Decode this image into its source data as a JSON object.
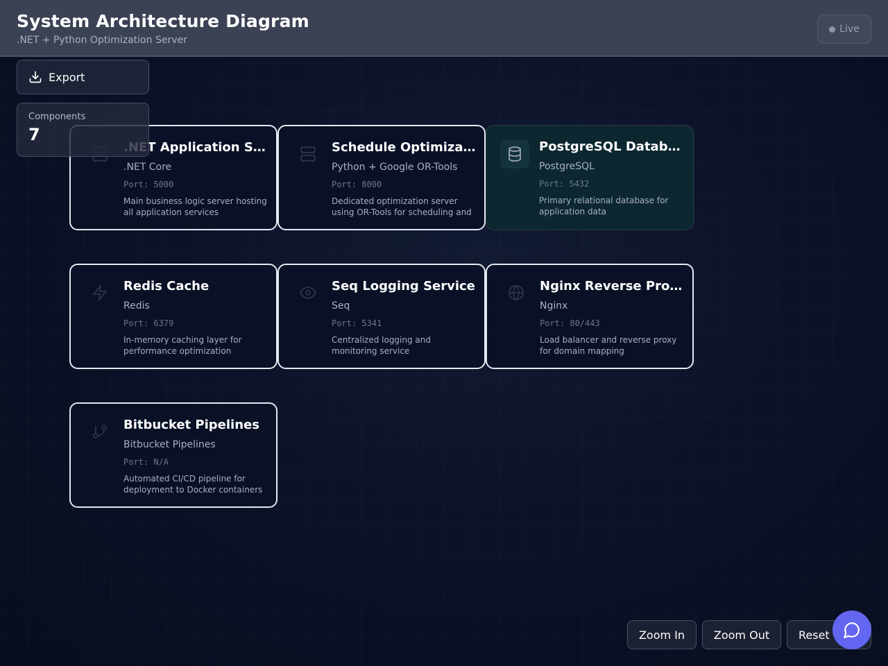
{
  "header": {
    "title": "System Architecture Diagram",
    "subtitle": ".NET + Python Optimization Server",
    "live_label": "Live"
  },
  "toolbar": {
    "export_label": "Export"
  },
  "stats": {
    "components_label": "Components",
    "components_value": "7"
  },
  "components": [
    {
      "icon": "server-icon",
      "title": ".NET Application Server",
      "tech": ".NET Core",
      "port": "Port: 5000",
      "description": "Main business logic server hosting all application services"
    },
    {
      "icon": "server-icon",
      "title": "Schedule Optimization Server",
      "tech": "Python + Google OR-Tools",
      "port": "Port: 8000",
      "description": "Dedicated optimization server using OR-Tools for scheduling and resource allocation"
    },
    {
      "icon": "database-icon",
      "title": "PostgreSQL Database",
      "tech": "PostgreSQL",
      "port": "Port: 5432",
      "description": "Primary relational database for application data"
    },
    {
      "icon": "lightning-icon",
      "title": "Redis Cache",
      "tech": "Redis",
      "port": "Port: 6379",
      "description": "In-memory caching layer for performance optimization"
    },
    {
      "icon": "eye-icon",
      "title": "Seq Logging Service",
      "tech": "Seq",
      "port": "Port: 5341",
      "description": "Centralized logging and monitoring service"
    },
    {
      "icon": "globe-icon",
      "title": "Nginx Reverse Proxy",
      "tech": "Nginx",
      "port": "Port: 80/443",
      "description": "Load balancer and reverse proxy for domain mapping"
    },
    {
      "icon": "git-branch-icon",
      "title": "Bitbucket Pipelines",
      "tech": "Bitbucket Pipelines",
      "port": "Port: N/A",
      "description": "Automated CI/CD pipeline for deployment to Docker containers"
    }
  ],
  "controls": {
    "zoom_in": "Zoom In",
    "zoom_out": "Zoom Out",
    "reset": "Reset"
  },
  "colors": {
    "accent": "#6366f1",
    "header_bg": "#3b4254",
    "selected_card_bg": "#0c2730",
    "card_border": "#e6e9f0"
  }
}
